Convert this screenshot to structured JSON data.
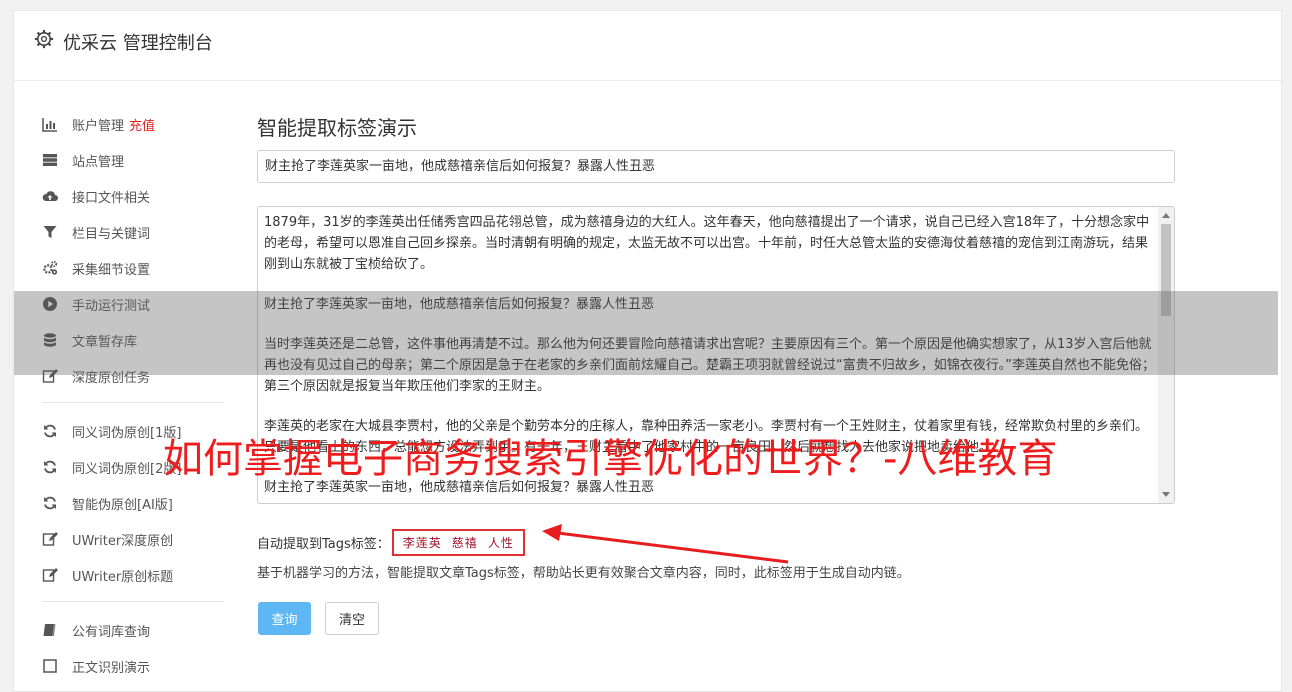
{
  "header": {
    "title": "优采云 管理控制台"
  },
  "sidebar": {
    "groups": [
      [
        {
          "label": "账户管理",
          "badge": "充值",
          "icon": "bar-chart-icon"
        },
        {
          "label": "站点管理",
          "icon": "server-icon"
        },
        {
          "label": "接口文件相关",
          "icon": "cloud-upload-icon"
        },
        {
          "label": "栏目与关键词",
          "icon": "filter-icon"
        },
        {
          "label": "采集细节设置",
          "icon": "cogs-icon"
        },
        {
          "label": "手动运行测试",
          "icon": "play-circle-icon"
        },
        {
          "label": "文章暂存库",
          "icon": "database-icon"
        },
        {
          "label": "深度原创任务",
          "icon": "edit-icon"
        }
      ],
      [
        {
          "label": "同义词伪原创[1版]",
          "icon": "refresh-icon"
        },
        {
          "label": "同义词伪原创[2版]",
          "icon": "refresh-icon"
        },
        {
          "label": "智能伪原创[AI版]",
          "icon": "refresh-icon"
        },
        {
          "label": "UWriter深度原创",
          "icon": "edit-icon"
        },
        {
          "label": "UWriter原创标题",
          "icon": "edit-icon"
        }
      ],
      [
        {
          "label": "公有词库查询",
          "icon": "book-icon"
        },
        {
          "label": "正文识别演示",
          "icon": "document-icon"
        }
      ]
    ]
  },
  "main": {
    "page_title": "智能提取标签演示",
    "title_input_value": "财主抢了李莲英家一亩地，他成慈禧亲信后如何报复？暴露人性丑恶",
    "body_paragraphs": [
      "1879年，31岁的李莲英出任储秀宫四品花翎总管，成为慈禧身边的大红人。这年春天，他向慈禧提出了一个请求，说自己已经入宫18年了，十分想念家中的老母，希望可以恩准自己回乡探亲。当时清朝有明确的规定，太监无故不可以出宫。十年前，时任大总管太监的安德海仗着慈禧的宠信到江南游玩，结果刚到山东就被丁宝桢给砍了。",
      "财主抢了李莲英家一亩地，他成慈禧亲信后如何报复？暴露人性丑恶",
      "当时李莲英还是二总管，这件事他再清楚不过。那么他为何还要冒险向慈禧请求出宫呢？主要原因有三个。第一个原因是他确实想家了，从13岁入宫后他就再也没有见过自己的母亲；第二个原因是急于在老家的乡亲们面前炫耀自己。楚霸王项羽就曾经说过“富贵不归故乡，如锦衣夜行。”李莲英自然也不能免俗；第三个原因就是报复当年欺压他们李家的王财主。",
      "李莲英的老家在大城县李贾村，他的父亲是个勤劳本分的庄稼人，靠种田养活一家老小。李贾村有一个王姓财主，仗着家里有钱，经常欺负村里的乡亲们。只要是他看上的东西，总能想方设法弄到手。有一年，王财主看中了他家村中的一亩良田，然后就想找人去他家说把地卖给他。",
      "财主抢了李莲英家一亩地，他成慈禧亲信后如何报复？暴露人性丑恶"
    ],
    "tags_label": "自动提取到Tags标签：",
    "tags": [
      "李莲英",
      "慈禧",
      "人性"
    ],
    "description": "基于机器学习的方法，智能提取文章Tags标签，帮助站长更有效聚合文章内容，同时，此标签用于生成自动内链。",
    "query_button": "查询",
    "clear_button": "清空"
  },
  "watermark": "如何掌握电子商务搜索引擎优化的世界？-八维教育",
  "colors": {
    "accent": "#5fb6f5",
    "badge": "#e02020",
    "tag_text": "#a0142a",
    "watermark": "#ee1c1c"
  }
}
